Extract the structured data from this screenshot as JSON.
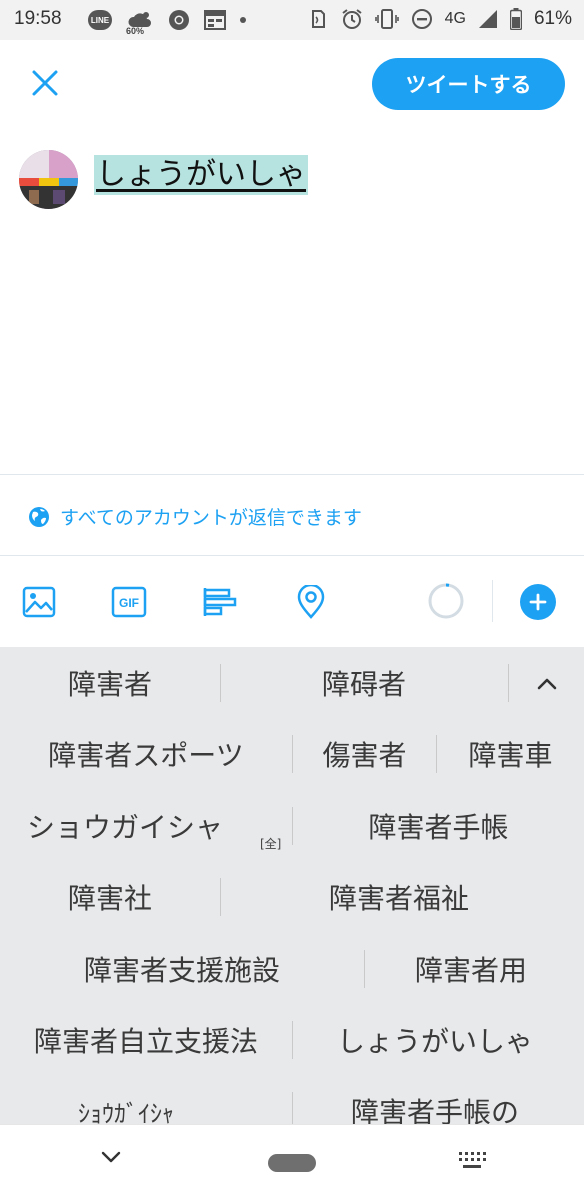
{
  "status_bar": {
    "time": "19:58",
    "line_label": "LINE",
    "weather_percent": "60%",
    "network": "4G",
    "battery": "61%"
  },
  "header": {
    "tweet_button_label": "ツイートする"
  },
  "composer": {
    "text": "しょうがいしゃ"
  },
  "reply_setting": {
    "label": "すべてのアカウントが返信できます"
  },
  "toolbar": {
    "icons": [
      "image-icon",
      "gif-icon",
      "poll-icon",
      "location-icon"
    ],
    "gif_label": "GIF",
    "accent_color": "#1da1f2"
  },
  "suggestions": {
    "rows": [
      [
        "障害者",
        "障碍者"
      ],
      [
        "障害者スポーツ",
        "傷害者",
        "障害車"
      ],
      [
        "ショウガイシャ",
        "障害者手帳"
      ],
      [
        "障害社",
        "障害者福祉"
      ],
      [
        "障害者支援施設",
        "障害者用"
      ],
      [
        "障害者自立支援法",
        "しょうがいしゃ"
      ],
      [
        "ｼｮｳｶﾞｲｼｬ",
        "障害者手帳の"
      ]
    ],
    "fullwidth_tag": "[全]"
  }
}
